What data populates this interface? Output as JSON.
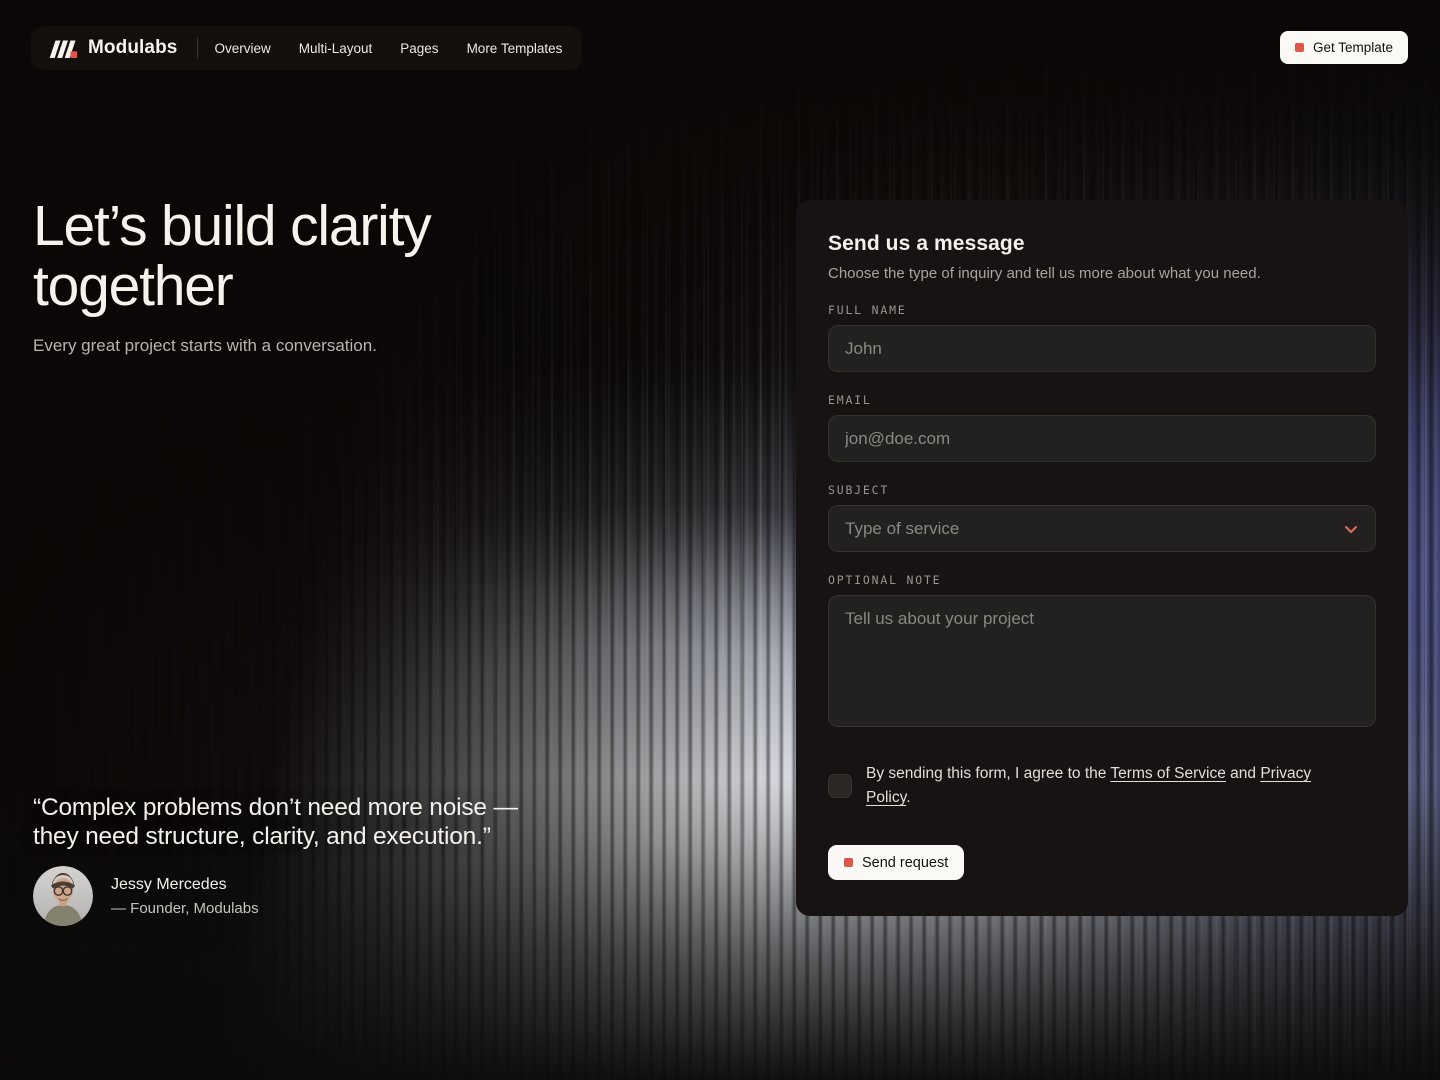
{
  "nav": {
    "brand": "Modulabs",
    "links": [
      {
        "label": "Overview"
      },
      {
        "label": "Multi-Layout"
      },
      {
        "label": "Pages"
      },
      {
        "label": "More Templates"
      }
    ],
    "cta_label": "Get Template"
  },
  "hero": {
    "title_line1": "Let’s build clarity",
    "title_line2": "together",
    "subtitle": "Every great project starts with a conversation."
  },
  "quote": {
    "text": "“Complex problems don’t need more noise — they need structure, clarity, and execution.”",
    "author": "Jessy Mercedes",
    "role": "— Founder, Modulabs"
  },
  "form": {
    "title": "Send us a message",
    "subtitle": "Choose the type of inquiry and tell us more about what you need.",
    "full_name": {
      "label": "FULL NAME",
      "placeholder": "John"
    },
    "email": {
      "label": "EMAIL",
      "placeholder": "jon@doe.com"
    },
    "subject": {
      "label": "SUBJECT",
      "value": "Type of service"
    },
    "note": {
      "label": "OPTIONAL NOTE",
      "placeholder": "Tell us about your project"
    },
    "consent": {
      "prefix": "By sending this form, I agree to the ",
      "terms_link": "Terms of Service",
      "conjunction": " and ",
      "privacy_link": "Privacy Policy",
      "suffix": "."
    },
    "submit_label": "Send request"
  },
  "icons": {
    "logo": "modulabs-m-logo",
    "cta_square": "accent-square",
    "subject_chevron": "chevron-down",
    "submit_square": "accent-square"
  },
  "colors": {
    "accent": "#E2564A",
    "chevron": "#E0705C",
    "page_bg": "#0A0706",
    "card_bg": "#161312",
    "field_bg": "#232120",
    "button_bg": "#FBF9F6"
  }
}
